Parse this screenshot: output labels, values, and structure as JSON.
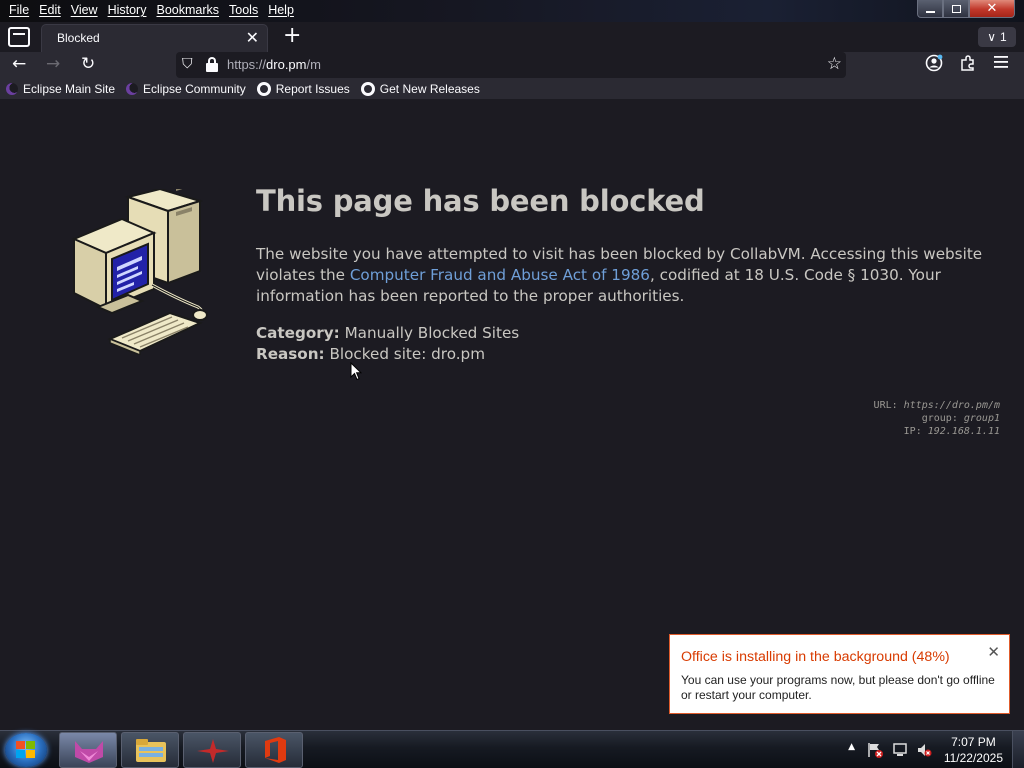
{
  "menubar": {
    "items": [
      "File",
      "Edit",
      "View",
      "History",
      "Bookmarks",
      "Tools",
      "Help"
    ]
  },
  "tabs": {
    "active_title": "Blocked",
    "overflow_count": "1"
  },
  "urlbar": {
    "scheme": "https://",
    "host": "dro.pm",
    "path": "/m"
  },
  "bookmarks": [
    {
      "label": "Eclipse Main Site",
      "icon": "eclipse-icon"
    },
    {
      "label": "Eclipse Community",
      "icon": "eclipse-icon"
    },
    {
      "label": "Report Issues",
      "icon": "github-icon"
    },
    {
      "label": "Get New Releases",
      "icon": "github-icon"
    }
  ],
  "page": {
    "title": "This page has been blocked",
    "desc_before": "The website you have attempted to visit has been blocked by CollabVM. Accessing this website violates the ",
    "desc_link": "Computer Fraud and Abuse Act of 1986",
    "desc_after": ", codified at 18 U.S. Code § 1030. Your information has been reported to the proper authorities.",
    "category_label": "Category:",
    "category_value": "Manually Blocked Sites",
    "reason_label": "Reason:",
    "reason_value": "Blocked site: dro.pm",
    "meta": {
      "url_label": "URL:",
      "url_value": "https://dro.pm/m",
      "group_label": "group:",
      "group_value": "group1",
      "ip_label": "IP:",
      "ip_value": "192.168.1.11"
    }
  },
  "toast": {
    "title": "Office is installing in the background (48%)",
    "body": "You can use your programs now, but please don't go offline or restart your computer.",
    "progress_percent": 48
  },
  "taskbar": {
    "time": "7:07 PM",
    "date": "11/22/2025"
  },
  "colors": {
    "page_bg": "#1c1b22",
    "toolbar_bg": "#2b2a33",
    "text": "#c9c7c2",
    "link": "#6f9fd8",
    "office_orange": "#d83b01"
  }
}
